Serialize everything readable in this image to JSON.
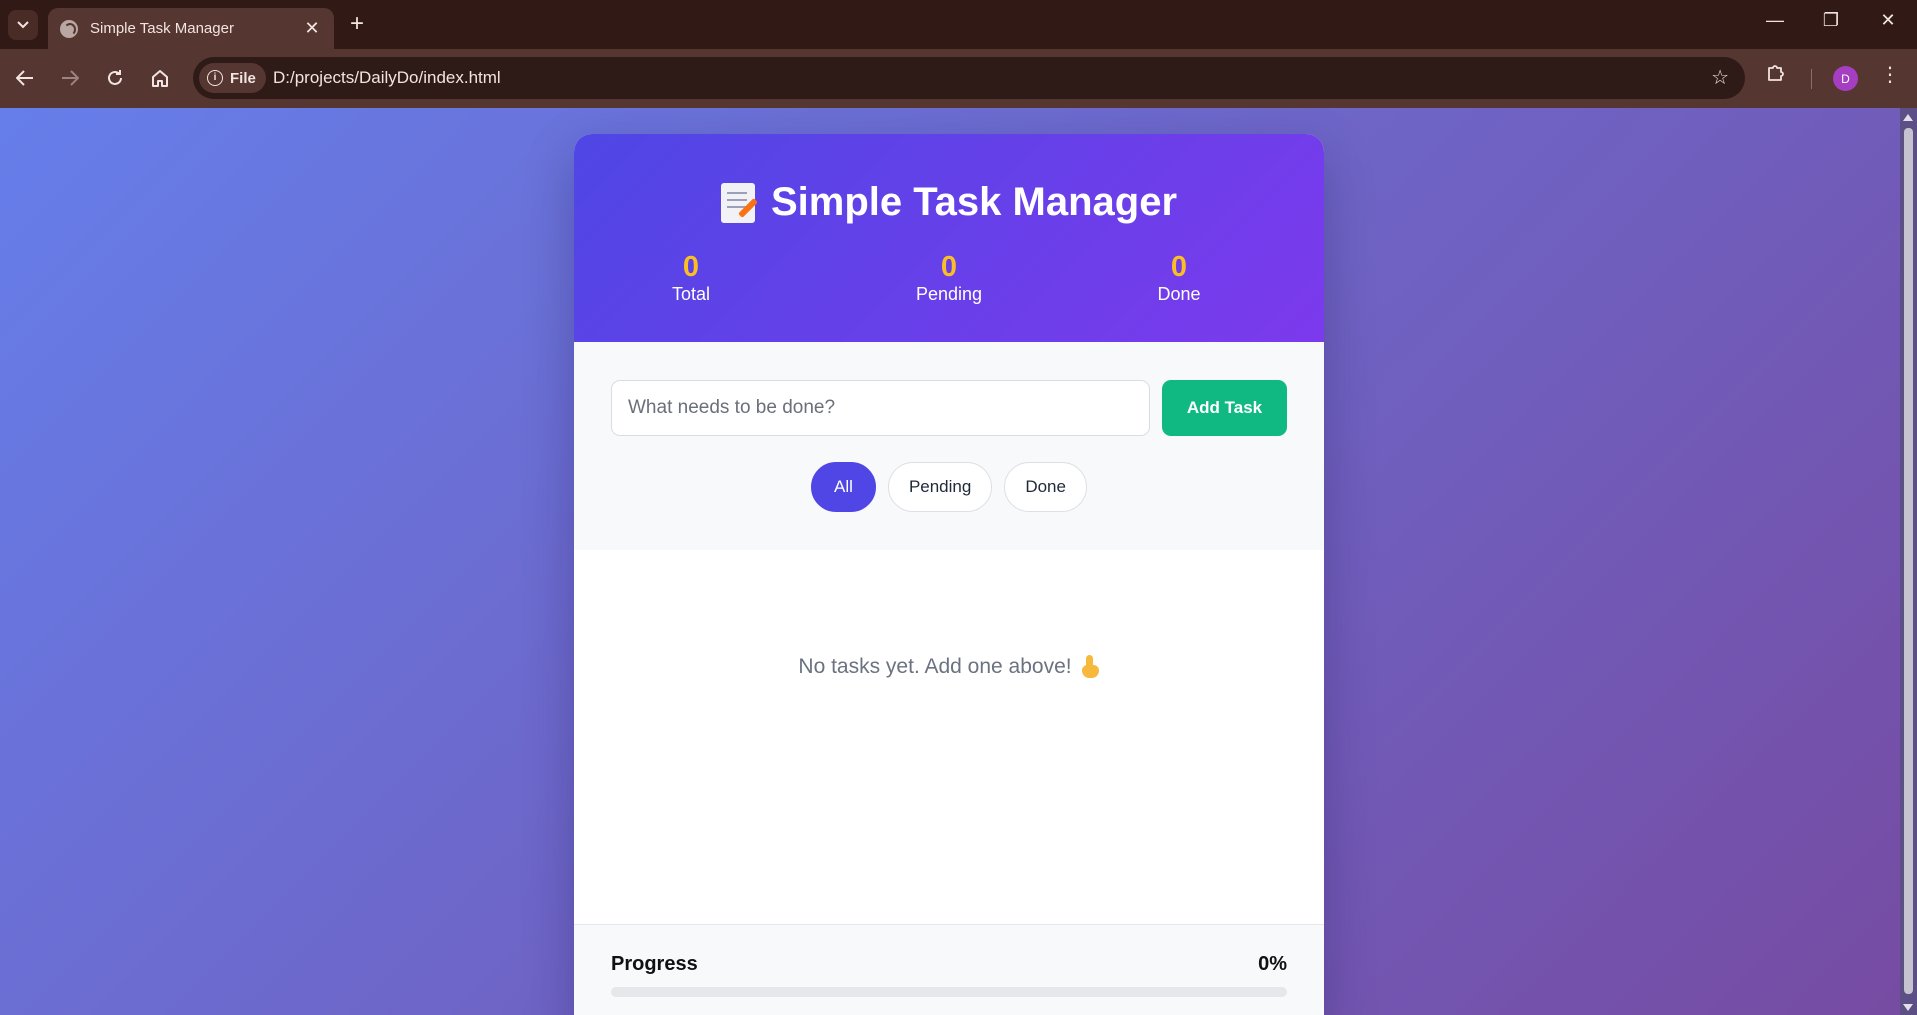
{
  "browser": {
    "tab_title": "Simple Task Manager",
    "chip_label": "File",
    "url": "D:/projects/DailyDo/index.html",
    "profile_initial": "D"
  },
  "app": {
    "title": "Simple Task Manager",
    "stats": {
      "total": {
        "value": "0",
        "label": "Total"
      },
      "pending": {
        "value": "0",
        "label": "Pending"
      },
      "done": {
        "value": "0",
        "label": "Done"
      }
    },
    "input": {
      "placeholder": "What needs to be done?",
      "value": ""
    },
    "add_button_label": "Add Task",
    "filters": [
      {
        "label": "All",
        "active": true
      },
      {
        "label": "Pending",
        "active": false
      },
      {
        "label": "Done",
        "active": false
      }
    ],
    "empty_message": "No tasks yet. Add one above!",
    "progress": {
      "label": "Progress",
      "percent_text": "0%",
      "fraction": 0
    }
  },
  "colors": {
    "accent": "#4f46e5",
    "success": "#10b981",
    "stat_value": "#fbbf24"
  }
}
